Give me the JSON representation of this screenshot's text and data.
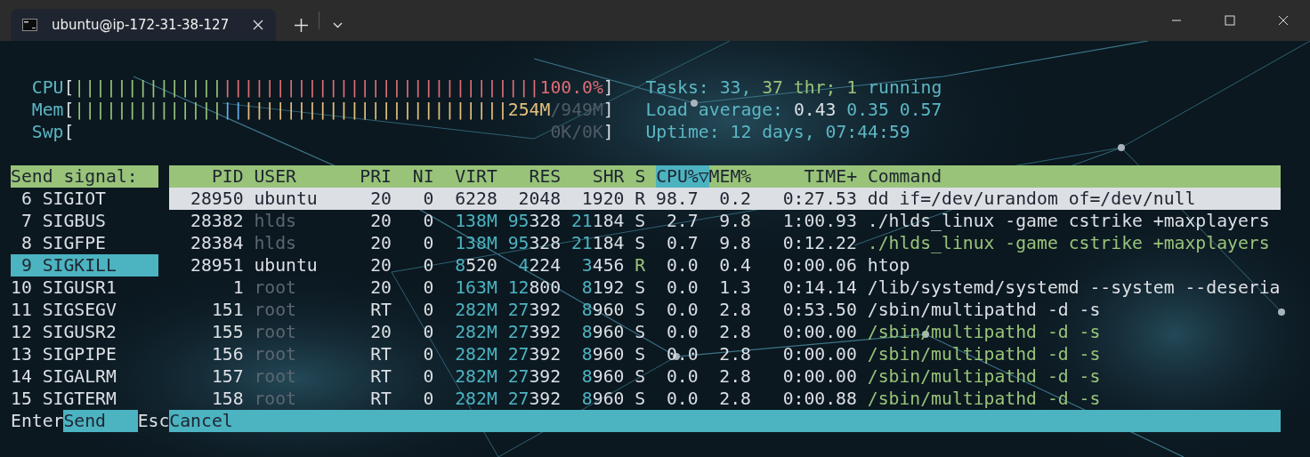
{
  "window": {
    "tab_title": "ubuntu@ip-172-31-38-127"
  },
  "meters": [
    {
      "label": "CPU",
      "open": "[",
      "bar": [
        {
          "text": "||||||||||||||",
          "color": "#98c379"
        },
        {
          "text": "||||||||||||||||||||||||||||||",
          "color": "#e06c75"
        }
      ],
      "value": [
        {
          "text": "100.0%",
          "color": "#e06c75"
        }
      ],
      "close": "]"
    },
    {
      "label": "Mem",
      "open": "[",
      "bar": [
        {
          "text": "||||||||||||||",
          "color": "#98c379"
        },
        {
          "text": "||",
          "color": "#61afef"
        },
        {
          "text": "|||||||||||||||||||||||||",
          "color": "#e5c07b"
        }
      ],
      "value": [
        {
          "text": "254M",
          "color": "#e5c07b"
        },
        {
          "text": "/949M",
          "color": "#4f5b66"
        }
      ],
      "close": "]"
    },
    {
      "label": "Swp",
      "open": "[",
      "value": [
        {
          "text": "0K/0K",
          "color": "#4f5b66"
        }
      ],
      "close": "]"
    }
  ],
  "info": [
    {
      "runs": [
        {
          "text": "Tasks: 33, ",
          "color": "#5cb6c4"
        },
        {
          "text": "37 thr; 1",
          "color": "#98c379"
        },
        {
          "text": " running",
          "color": "#5cb6c4"
        }
      ]
    },
    {
      "runs": [
        {
          "text": "Load average: ",
          "color": "#5cb6c4"
        },
        {
          "text": "0.43 ",
          "color": "#dcdfe4"
        },
        {
          "text": "0.35 0.57",
          "color": "#5cb6c4"
        }
      ]
    },
    {
      "runs": [
        {
          "text": "Uptime: 12 days, 07:44:59",
          "color": "#5cb6c4"
        }
      ]
    }
  ],
  "signal_panel": {
    "title": "Send signal:",
    "items": [
      {
        "number": "6",
        "name": "SIGIOT",
        "selected": false
      },
      {
        "number": "7",
        "name": "SIGBUS",
        "selected": false
      },
      {
        "number": "8",
        "name": "SIGFPE",
        "selected": false
      },
      {
        "number": "9",
        "name": "SIGKILL",
        "selected": true
      },
      {
        "number": "10",
        "name": "SIGUSR1",
        "selected": false
      },
      {
        "number": "11",
        "name": "SIGSEGV",
        "selected": false
      },
      {
        "number": "12",
        "name": "SIGUSR2",
        "selected": false
      },
      {
        "number": "13",
        "name": "SIGPIPE",
        "selected": false
      },
      {
        "number": "14",
        "name": "SIGALRM",
        "selected": false
      },
      {
        "number": "15",
        "name": "SIGTERM",
        "selected": false
      }
    ]
  },
  "table": {
    "columns": [
      {
        "label": "PID",
        "sorted": false
      },
      {
        "label": "USER",
        "sorted": false
      },
      {
        "label": "PRI",
        "sorted": false
      },
      {
        "label": "NI",
        "sorted": false
      },
      {
        "label": "VIRT",
        "sorted": false
      },
      {
        "label": "RES",
        "sorted": false
      },
      {
        "label": "SHR",
        "sorted": false
      },
      {
        "label": "S",
        "sorted": false
      },
      {
        "label": "CPU%",
        "sorted": true,
        "sort_indicator": "▽"
      },
      {
        "label": "MEM%",
        "sorted": false
      },
      {
        "label": "TIME+",
        "sorted": false
      },
      {
        "label": "Command",
        "sorted": false
      }
    ],
    "rows": [
      {
        "pid": "28950",
        "user": "ubuntu",
        "pri": "20",
        "ni": "0",
        "virt": {
          "lo": "6228"
        },
        "res": {
          "lo": "2048"
        },
        "shr": {
          "lo": "1920"
        },
        "state": "R",
        "cpu": "98.7",
        "mem": "0.2",
        "time": "0:27.53",
        "command": "dd if=/dev/urandom of=/dev/null",
        "selected": true,
        "running": true,
        "other_user": false,
        "thread": false
      },
      {
        "pid": "28382",
        "user": "hlds",
        "pri": "20",
        "ni": "0",
        "virt": {
          "hi": "138M"
        },
        "res": {
          "hi": "95",
          "lo": "328"
        },
        "shr": {
          "hi": "21",
          "lo": "184"
        },
        "state": "S",
        "cpu": "2.7",
        "mem": "9.8",
        "time": "1:00.93",
        "command": "./hlds_linux -game cstrike +maxplayers",
        "selected": false,
        "running": false,
        "other_user": true,
        "thread": false
      },
      {
        "pid": "28384",
        "user": "hlds",
        "pri": "20",
        "ni": "0",
        "virt": {
          "hi": "138M"
        },
        "res": {
          "hi": "95",
          "lo": "328"
        },
        "shr": {
          "hi": "21",
          "lo": "184"
        },
        "state": "S",
        "cpu": "0.7",
        "mem": "9.8",
        "time": "0:12.22",
        "command": "./hlds_linux -game cstrike +maxplayers",
        "selected": false,
        "running": false,
        "other_user": true,
        "thread": true
      },
      {
        "pid": "28951",
        "user": "ubuntu",
        "pri": "20",
        "ni": "0",
        "virt": {
          "hi": "8",
          "lo": "520"
        },
        "res": {
          "hi": "4",
          "lo": "224"
        },
        "shr": {
          "hi": "3",
          "lo": "456"
        },
        "state": "R",
        "cpu": "0.0",
        "mem": "0.4",
        "time": "0:00.06",
        "command": "htop",
        "selected": false,
        "running": true,
        "other_user": false,
        "thread": false
      },
      {
        "pid": "1",
        "user": "root",
        "pri": "20",
        "ni": "0",
        "virt": {
          "hi": "163M"
        },
        "res": {
          "hi": "12",
          "lo": "800"
        },
        "shr": {
          "hi": "8",
          "lo": "192"
        },
        "state": "S",
        "cpu": "0.0",
        "mem": "1.3",
        "time": "0:14.14",
        "command": "/lib/systemd/systemd --system --deseria",
        "selected": false,
        "running": false,
        "other_user": true,
        "thread": false
      },
      {
        "pid": "151",
        "user": "root",
        "pri": "RT",
        "ni": "0",
        "virt": {
          "hi": "282M"
        },
        "res": {
          "hi": "27",
          "lo": "392"
        },
        "shr": {
          "hi": "8",
          "lo": "960"
        },
        "state": "S",
        "cpu": "0.0",
        "mem": "2.8",
        "time": "0:53.50",
        "command": "/sbin/multipathd -d -s",
        "selected": false,
        "running": false,
        "other_user": true,
        "thread": false
      },
      {
        "pid": "155",
        "user": "root",
        "pri": "20",
        "ni": "0",
        "virt": {
          "hi": "282M"
        },
        "res": {
          "hi": "27",
          "lo": "392"
        },
        "shr": {
          "hi": "8",
          "lo": "960"
        },
        "state": "S",
        "cpu": "0.0",
        "mem": "2.8",
        "time": "0:00.00",
        "command": "/sbin/multipathd -d -s",
        "selected": false,
        "running": false,
        "other_user": true,
        "thread": true
      },
      {
        "pid": "156",
        "user": "root",
        "pri": "RT",
        "ni": "0",
        "virt": {
          "hi": "282M"
        },
        "res": {
          "hi": "27",
          "lo": "392"
        },
        "shr": {
          "hi": "8",
          "lo": "960"
        },
        "state": "S",
        "cpu": "0.0",
        "mem": "2.8",
        "time": "0:00.00",
        "command": "/sbin/multipathd -d -s",
        "selected": false,
        "running": false,
        "other_user": true,
        "thread": true
      },
      {
        "pid": "157",
        "user": "root",
        "pri": "RT",
        "ni": "0",
        "virt": {
          "hi": "282M"
        },
        "res": {
          "hi": "27",
          "lo": "392"
        },
        "shr": {
          "hi": "8",
          "lo": "960"
        },
        "state": "S",
        "cpu": "0.0",
        "mem": "2.8",
        "time": "0:00.00",
        "command": "/sbin/multipathd -d -s",
        "selected": false,
        "running": false,
        "other_user": true,
        "thread": true
      },
      {
        "pid": "158",
        "user": "root",
        "pri": "RT",
        "ni": "0",
        "virt": {
          "hi": "282M"
        },
        "res": {
          "hi": "27",
          "lo": "392"
        },
        "shr": {
          "hi": "8",
          "lo": "960"
        },
        "state": "S",
        "cpu": "0.0",
        "mem": "2.8",
        "time": "0:00.88",
        "command": "/sbin/multipathd -d -s",
        "selected": false,
        "running": false,
        "other_user": true,
        "thread": true
      }
    ]
  },
  "footer": [
    {
      "key": "Enter",
      "action": "Send"
    },
    {
      "key": "Esc",
      "action": "Cancel"
    }
  ]
}
